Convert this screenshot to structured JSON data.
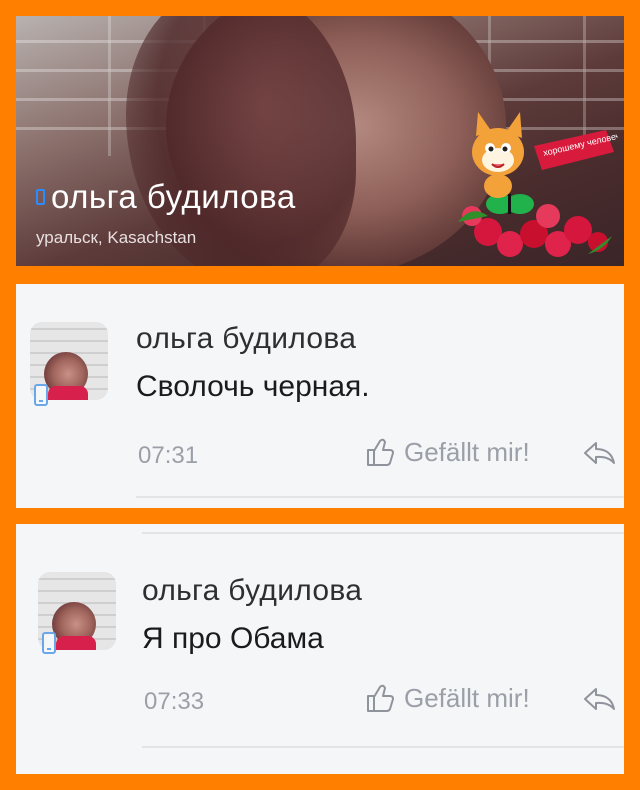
{
  "profile": {
    "name": "ольга будилова",
    "location": "уральск, Kasachstan",
    "sticker_text": "хорошему человечку"
  },
  "comments": [
    {
      "author": "ольга будилова",
      "text": "Сволочь черная.",
      "time": "07:31",
      "like_label": "Gefällt mir!"
    },
    {
      "author": "ольга будилова",
      "text": "Я про Обама",
      "time": "07:33",
      "like_label": "Gefällt mir!"
    }
  ],
  "colors": {
    "frame": "#ff7f00",
    "panel": "#f5f6f8",
    "mobile_icon": "#6aa7e8"
  },
  "icons": [
    "mobile-icon",
    "thumbs-up-icon",
    "reply-icon"
  ]
}
